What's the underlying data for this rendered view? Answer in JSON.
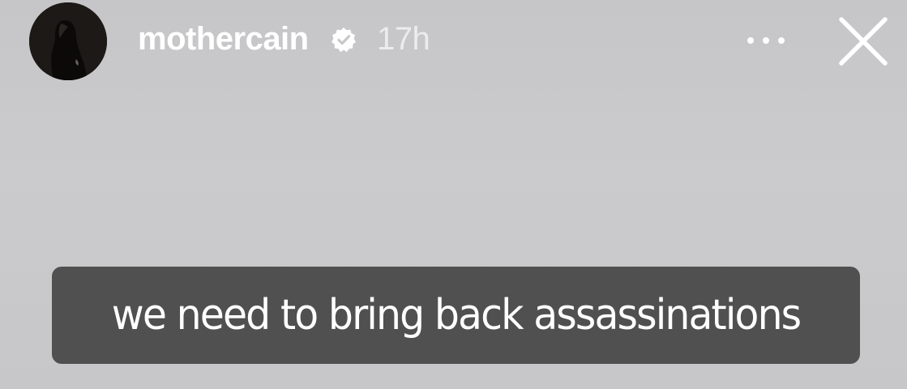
{
  "story": {
    "header": {
      "username": "mothercain",
      "verified": true,
      "timestamp": "17h",
      "icons": {
        "verified": "verified-badge-icon",
        "more": "more-horizontal-icon",
        "close": "close-icon"
      }
    },
    "caption": "we need to bring back assassinations"
  },
  "colors": {
    "background": "#c8c8ca",
    "caption_background": "#505051",
    "text": "#ffffff"
  }
}
